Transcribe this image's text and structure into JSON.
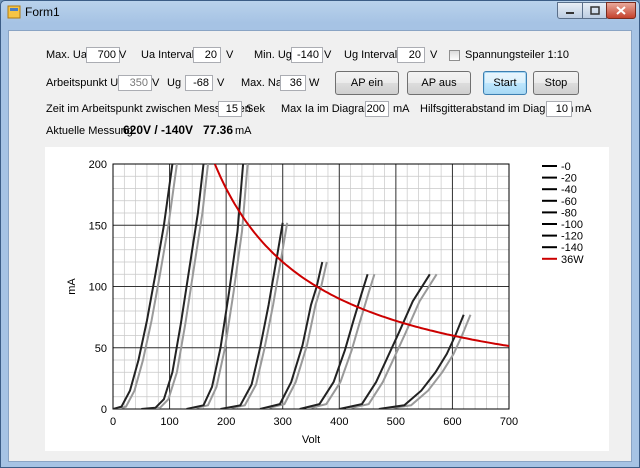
{
  "window": {
    "title": "Form1"
  },
  "form": {
    "max_ua": {
      "label": "Max. Ua",
      "value": "700",
      "unit": "V"
    },
    "ua_intervall": {
      "label": "Ua Intervall",
      "value": "20",
      "unit": "V"
    },
    "min_ug": {
      "label": "Min. Ug",
      "value": "-140",
      "unit": "V"
    },
    "ug_intervall": {
      "label": "Ug Intervall",
      "value": "20",
      "unit": "V"
    },
    "spannungsteiler": {
      "label": "Spannungsteiler 1:10",
      "checked": false
    },
    "arbeitspunkt_ua": {
      "label": "Arbeitspunkt Ua",
      "value": "350",
      "unit": "V"
    },
    "ug": {
      "label": "Ug",
      "value": "-68",
      "unit": "V"
    },
    "max_na": {
      "label": "Max. Na",
      "value": "36",
      "unit": "W"
    },
    "ap_ein": "AP ein",
    "ap_aus": "AP aus",
    "start": "Start",
    "stop": "Stop",
    "zeit": {
      "label": "Zeit im Arbeitspunkt zwischen Messungen",
      "value": "15",
      "unit": "Sek"
    },
    "max_ia": {
      "label": "Max Ia im Diagramm",
      "value": "200",
      "unit": "mA"
    },
    "hilfsgitter": {
      "label": "Hilfsgitterabstand im Diagramm",
      "value": "10",
      "unit": "mA"
    },
    "aktuelle": {
      "label": "Aktuelle Messung",
      "voltage": "620V / -140V",
      "current": "77.36",
      "unit": "mA"
    }
  },
  "chart_data": {
    "type": "line",
    "xlabel": "Volt",
    "ylabel": "mA",
    "xlim": [
      0,
      700
    ],
    "ylim": [
      0,
      200
    ],
    "x_ticks": [
      0,
      100,
      200,
      300,
      400,
      500,
      600,
      700
    ],
    "y_ticks": [
      0,
      50,
      100,
      150,
      200
    ],
    "minor_grid": {
      "x_step": 20,
      "y_step": 10
    },
    "legend_position": "right",
    "series": [
      {
        "name": "-0",
        "color": "#000000",
        "points": [
          [
            0,
            0
          ],
          [
            15,
            2
          ],
          [
            30,
            15
          ],
          [
            45,
            40
          ],
          [
            60,
            72
          ],
          [
            75,
            110
          ],
          [
            90,
            150
          ],
          [
            105,
            200
          ]
        ],
        "shadow_offset": 8
      },
      {
        "name": "-20",
        "color": "#000000",
        "points": [
          [
            50,
            0
          ],
          [
            75,
            1
          ],
          [
            90,
            8
          ],
          [
            105,
            30
          ],
          [
            120,
            70
          ],
          [
            135,
            115
          ],
          [
            150,
            160
          ],
          [
            160,
            200
          ]
        ],
        "shadow_offset": 8
      },
      {
        "name": "-40",
        "color": "#000000",
        "points": [
          [
            130,
            0
          ],
          [
            160,
            3
          ],
          [
            175,
            18
          ],
          [
            190,
            50
          ],
          [
            205,
            95
          ],
          [
            220,
            145
          ],
          [
            230,
            200
          ]
        ],
        "shadow_offset": 8
      },
      {
        "name": "-60",
        "color": "#000000",
        "points": [
          [
            190,
            0
          ],
          [
            225,
            3
          ],
          [
            245,
            20
          ],
          [
            260,
            50
          ],
          [
            275,
            85
          ],
          [
            290,
            125
          ],
          [
            300,
            152
          ]
        ],
        "shadow_offset": 8
      },
      {
        "name": "-80",
        "color": "#000000",
        "points": [
          [
            260,
            0
          ],
          [
            295,
            4
          ],
          [
            315,
            22
          ],
          [
            335,
            52
          ],
          [
            350,
            85
          ],
          [
            360,
            100
          ],
          [
            370,
            120
          ]
        ],
        "shadow_offset": 8
      },
      {
        "name": "-100",
        "color": "#000000",
        "points": [
          [
            330,
            0
          ],
          [
            365,
            4
          ],
          [
            390,
            22
          ],
          [
            410,
            48
          ],
          [
            425,
            72
          ],
          [
            440,
            95
          ],
          [
            450,
            110
          ]
        ],
        "shadow_offset": 12
      },
      {
        "name": "-120",
        "color": "#000000",
        "points": [
          [
            400,
            0
          ],
          [
            440,
            4
          ],
          [
            465,
            22
          ],
          [
            485,
            42
          ],
          [
            505,
            62
          ],
          [
            530,
            88
          ],
          [
            560,
            110
          ]
        ],
        "shadow_offset": 12
      },
      {
        "name": "-140",
        "color": "#000000",
        "points": [
          [
            470,
            0
          ],
          [
            515,
            3
          ],
          [
            545,
            15
          ],
          [
            570,
            30
          ],
          [
            590,
            45
          ],
          [
            605,
            60
          ],
          [
            620,
            77
          ]
        ],
        "shadow_offset": 12
      },
      {
        "name": "36W",
        "color": "#cc0000",
        "power_w": 36
      }
    ]
  }
}
